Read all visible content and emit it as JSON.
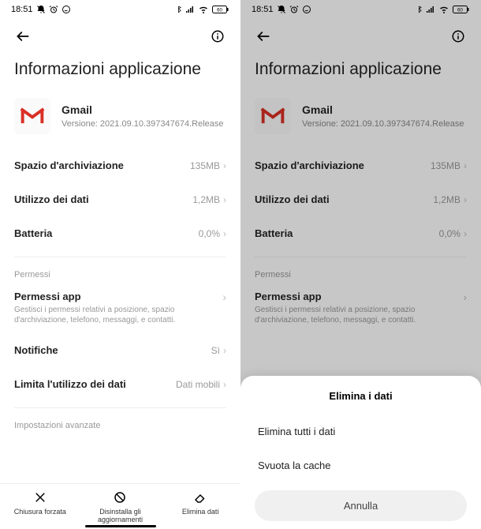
{
  "statusbar": {
    "time": "18:51"
  },
  "page_title": "Informazioni applicazione",
  "app": {
    "name": "Gmail",
    "version": "Versione: 2021.09.10.397347674.Release"
  },
  "rows": {
    "storage": {
      "label": "Spazio d'archiviazione",
      "value": "135MB"
    },
    "data": {
      "label": "Utilizzo dei dati",
      "value": "1,2MB"
    },
    "battery": {
      "label": "Batteria",
      "value": "0,0%"
    }
  },
  "sections": {
    "perms_label": "Permessi",
    "perms_app": {
      "title": "Permessi app",
      "sub": "Gestisci i permessi relativi a posizione, spazio d'archiviazione, telefono, messaggi, e contatti."
    },
    "notif": {
      "title": "Notifiche",
      "value": "Sì"
    },
    "limit": {
      "title": "Limita l'utilizzo dei dati",
      "value": "Dati mobili"
    },
    "advanced_label": "Impostazioni avanzate"
  },
  "bottombar": {
    "force": "Chiusura forzata",
    "uninstall": "Disinstalla gli aggiornamenti",
    "clear": "Elimina dati"
  },
  "sheet": {
    "title": "Elimina i dati",
    "opt1": "Elimina tutti i dati",
    "opt2": "Svuota la cache",
    "cancel": "Annulla"
  }
}
